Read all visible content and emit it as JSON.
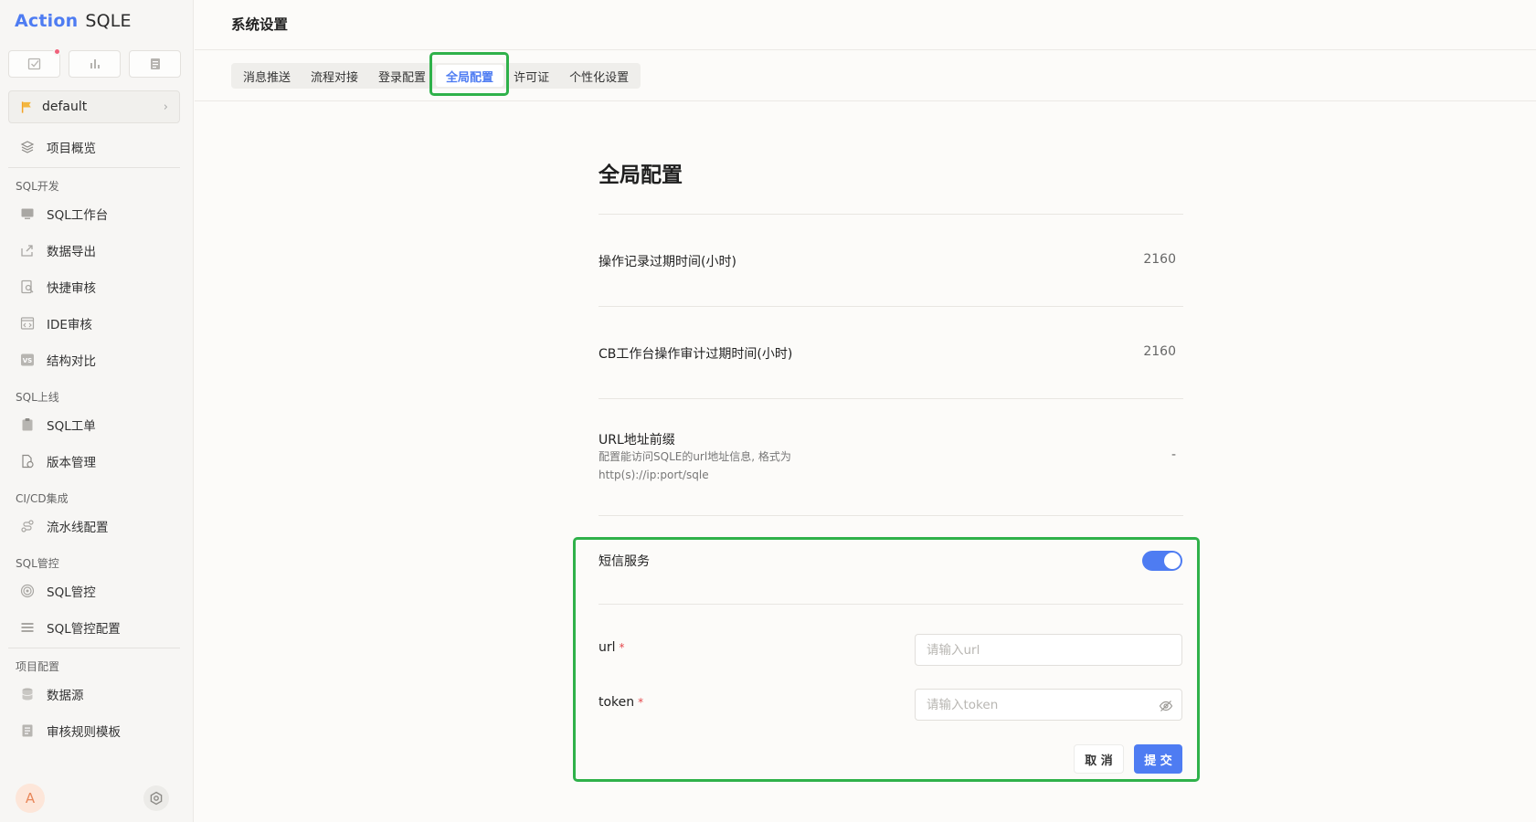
{
  "app": {
    "logo_part1": "Action",
    "logo_part2": "SQLE"
  },
  "sidebar": {
    "project": "default",
    "items": [
      {
        "label": "项目概览"
      },
      {
        "label": "SQL工作台"
      },
      {
        "label": "数据导出"
      },
      {
        "label": "快捷审核"
      },
      {
        "label": "IDE审核"
      },
      {
        "label": "结构对比"
      },
      {
        "label": "SQL工单"
      },
      {
        "label": "版本管理"
      },
      {
        "label": "流水线配置"
      },
      {
        "label": "SQL管控"
      },
      {
        "label": "SQL管控配置"
      },
      {
        "label": "数据源"
      },
      {
        "label": "审核规则模板"
      }
    ],
    "sections": [
      "SQL开发",
      "SQL上线",
      "CI/CD集成",
      "SQL管控",
      "项目配置"
    ],
    "avatar_letter": "A"
  },
  "header": {
    "title": "系统设置"
  },
  "tabs": [
    {
      "label": "消息推送"
    },
    {
      "label": "流程对接"
    },
    {
      "label": "登录配置"
    },
    {
      "label": "全局配置",
      "active": true
    },
    {
      "label": "许可证"
    },
    {
      "label": "个性化设置"
    }
  ],
  "global": {
    "title": "全局配置",
    "rows": [
      {
        "label": "操作记录过期时间(小时)",
        "value": "2160"
      },
      {
        "label": "CB工作台操作审计过期时间(小时)",
        "value": "2160"
      },
      {
        "label": "URL地址前缀",
        "desc": "配置能访问SQLE的url地址信息, 格式为 http(s)://ip:port/sqle",
        "value": "-"
      }
    ]
  },
  "sms": {
    "label": "短信服务",
    "enabled": true,
    "url_label": "url",
    "url_placeholder": "请输入url",
    "token_label": "token",
    "token_placeholder": "请输入token",
    "required_mark": "*",
    "cancel": "取 消",
    "submit": "提 交"
  },
  "colors": {
    "accent": "#4e7cf2",
    "highlight": "#2fb14a"
  }
}
